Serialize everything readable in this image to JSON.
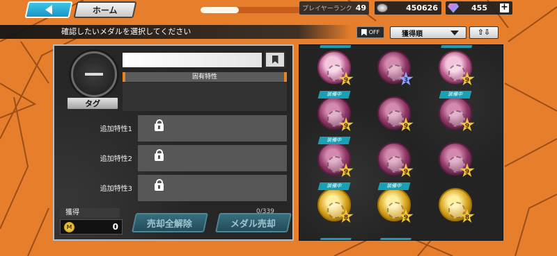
{
  "topbar": {
    "home_label": "ホーム",
    "exp_progress": 0.25,
    "rank_label": "プレイヤーランク",
    "rank_value": "49",
    "coins": "450626",
    "gems": "455",
    "plus_label": "+"
  },
  "instruction": "確認したいメダルを選択してください",
  "filters": {
    "bookmark_filter": "OFF",
    "sort_label": "獲得順",
    "order_label": "⇧⇩"
  },
  "detail": {
    "tag_label": "タグ",
    "unique_trait_label": "固有特性",
    "extra_traits": [
      {
        "label": "追加特性1"
      },
      {
        "label": "追加特性2"
      },
      {
        "label": "追加特性3"
      }
    ],
    "gain_label": "獲得",
    "gain_value": "0",
    "m_label": "M",
    "count_label": "0/339",
    "sell_release_label": "売却全解除",
    "sell_medal_label": "メダル売却"
  },
  "medals": [
    {
      "style": "pink",
      "level": "9",
      "equipped": false
    },
    {
      "style": "pinkdark",
      "level": "3",
      "equipped": false,
      "star": "blue"
    },
    {
      "style": "pink",
      "level": "9",
      "equipped": false
    },
    {
      "style": "pinkdark",
      "level": "9",
      "equipped": true
    },
    {
      "style": "pinkdark",
      "level": "9",
      "equipped": false
    },
    {
      "style": "pinkdark",
      "level": "9",
      "equipped": true
    },
    {
      "style": "pinkdark",
      "level": "9",
      "equipped": true
    },
    {
      "style": "pinkdark",
      "level": "9",
      "equipped": false
    },
    {
      "style": "pinkdark",
      "level": "9",
      "equipped": false
    },
    {
      "style": "gold",
      "level": "8",
      "equipped": true
    },
    {
      "style": "gold",
      "level": "9",
      "equipped": true
    },
    {
      "style": "gold",
      "level": "8",
      "equipped": false
    }
  ],
  "equipped_label": "装備中"
}
